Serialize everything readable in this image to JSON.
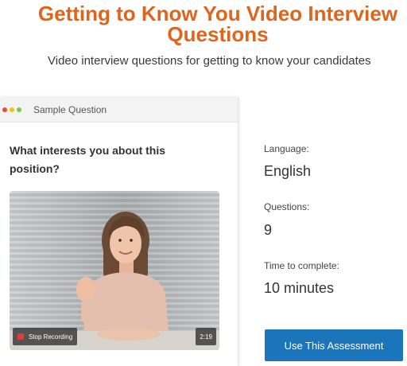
{
  "page": {
    "title": "Getting to Know You Video Interview Questions",
    "subtitle": "Video interview questions for getting to know your candidates"
  },
  "sample_card": {
    "header_label": "Sample Question",
    "window_dots": [
      "red",
      "yellow",
      "green"
    ],
    "question": "What interests you about this position?",
    "video": {
      "record_button_label": "Stop Recording",
      "duration": "2:19"
    }
  },
  "info": {
    "language_label": "Language:",
    "language_value": "English",
    "questions_label": "Questions:",
    "questions_value": "9",
    "time_label": "Time to complete:",
    "time_value": "10 minutes"
  },
  "actions": {
    "use_assessment_label": "Use This Assessment"
  },
  "colors": {
    "title": "#e0651c",
    "cta": "#1b75bb",
    "record_dot": "#e03a3a"
  }
}
